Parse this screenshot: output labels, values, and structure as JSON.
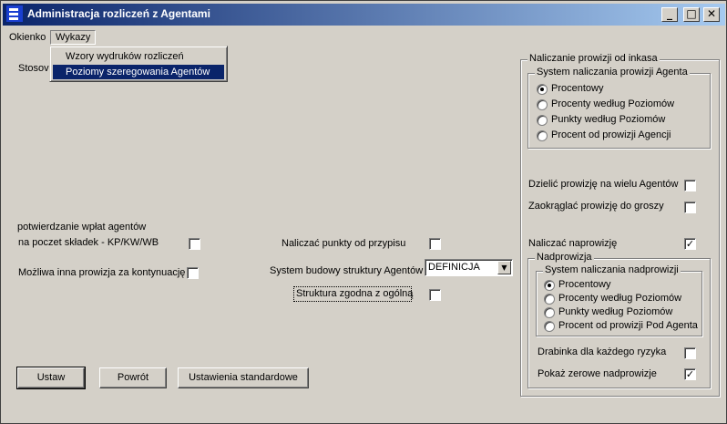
{
  "window": {
    "title": "Administracja rozliczeń z Agentami",
    "minimize_glyph": "_",
    "maximize_glyph": "□",
    "close_glyph": "✕"
  },
  "menubar": {
    "items": [
      {
        "label": "Okienko"
      },
      {
        "label": "Wykazy"
      }
    ],
    "dropdown": [
      {
        "label": "Wzory wydruków rozliczeń",
        "selected": false
      },
      {
        "label": "Poziomy szeregowania Agentów",
        "selected": true
      }
    ]
  },
  "left": {
    "stosow_label": "Stosov",
    "potwierdzanie_line1": "potwierdzanie wpłat agentów",
    "potwierdzanie_line2": "na poczet składek - KP/KW/WB",
    "mozliwa_label": "Możliwa inna prowizja za kontynuację"
  },
  "middle": {
    "naliczac_punkty_label": "Naliczać punkty od przypisu",
    "system_budowy_label": "System budowy struktury Agentów",
    "system_budowy_value": "DEFINICJA",
    "struktura_label": "Struktura zgodna z ogólną"
  },
  "right": {
    "inkaso_group": "Naliczanie prowizji od inkasa",
    "system_prowizji_group": "System naliczania prowizji Agenta",
    "prowizja_options": [
      {
        "label": "Procentowy",
        "selected": true
      },
      {
        "label": "Procenty według Poziomów",
        "selected": false
      },
      {
        "label": "Punkty według Poziomów",
        "selected": false
      },
      {
        "label": "Procent od prowizji Agencji",
        "selected": false
      }
    ],
    "dzielic_label": "Dzielić prowizję na wielu Agentów",
    "zaokraglac_label": "Zaokrąglać prowizję do groszy",
    "naliczac_naprowizje_label": "Naliczać naprowizję",
    "nadprowizja_group": "Nadprowizja",
    "system_nadprowizji_group": "System naliczania nadprowizji",
    "nadprowizja_options": [
      {
        "label": "Procentowy",
        "selected": true
      },
      {
        "label": "Procenty według Poziomów",
        "selected": false
      },
      {
        "label": "Punkty według Poziomów",
        "selected": false
      },
      {
        "label": "Procent od prowizji Pod Agenta",
        "selected": false
      }
    ],
    "drabinka_label": "Drabinka dla każdego ryzyka",
    "pokaz_label": "Pokaż zerowe nadprowizje"
  },
  "checkboxes": {
    "potwierdzanie": false,
    "mozliwa": false,
    "naliczac_punkty": false,
    "struktura": false,
    "dzielic": false,
    "zaokraglac": false,
    "naliczac_naprowizje": true,
    "drabinka": false,
    "pokaz": true
  },
  "check_glyph": "✓",
  "buttons": {
    "ustaw": "Ustaw",
    "powrot": "Powrót",
    "standardowe": "Ustawienia standardowe"
  }
}
